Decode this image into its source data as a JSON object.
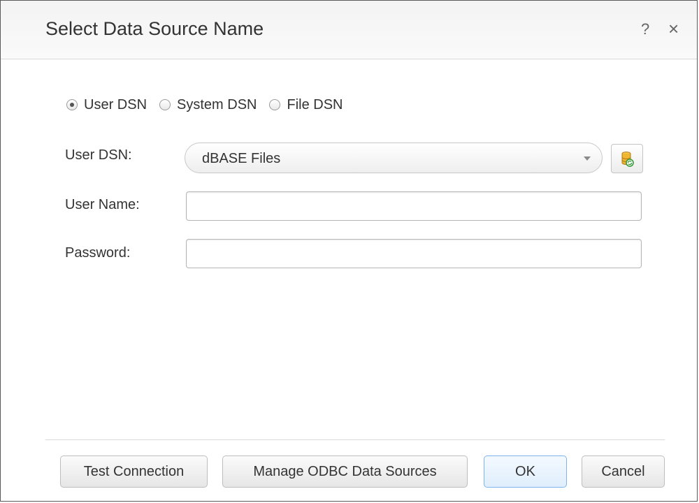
{
  "dialog": {
    "title": "Select Data Source Name",
    "help_icon": "?",
    "close_icon": "×"
  },
  "dsn_type": {
    "options": [
      {
        "label": "User DSN",
        "checked": true
      },
      {
        "label": "System DSN",
        "checked": false
      },
      {
        "label": "File DSN",
        "checked": false
      }
    ]
  },
  "form": {
    "user_dsn_label": "User DSN:",
    "user_dsn_value": "dBASE Files",
    "refresh_icon": "database-refresh-icon",
    "user_name_label": "User Name:",
    "user_name_value": "",
    "password_label": "Password:",
    "password_value": ""
  },
  "buttons": {
    "test_connection": "Test Connection",
    "manage_odbc": "Manage ODBC Data Sources",
    "ok": "OK",
    "cancel": "Cancel"
  },
  "colors": {
    "primary_button_border": "#7eb4ea",
    "refresh_icon_accent": "#e0a526"
  }
}
